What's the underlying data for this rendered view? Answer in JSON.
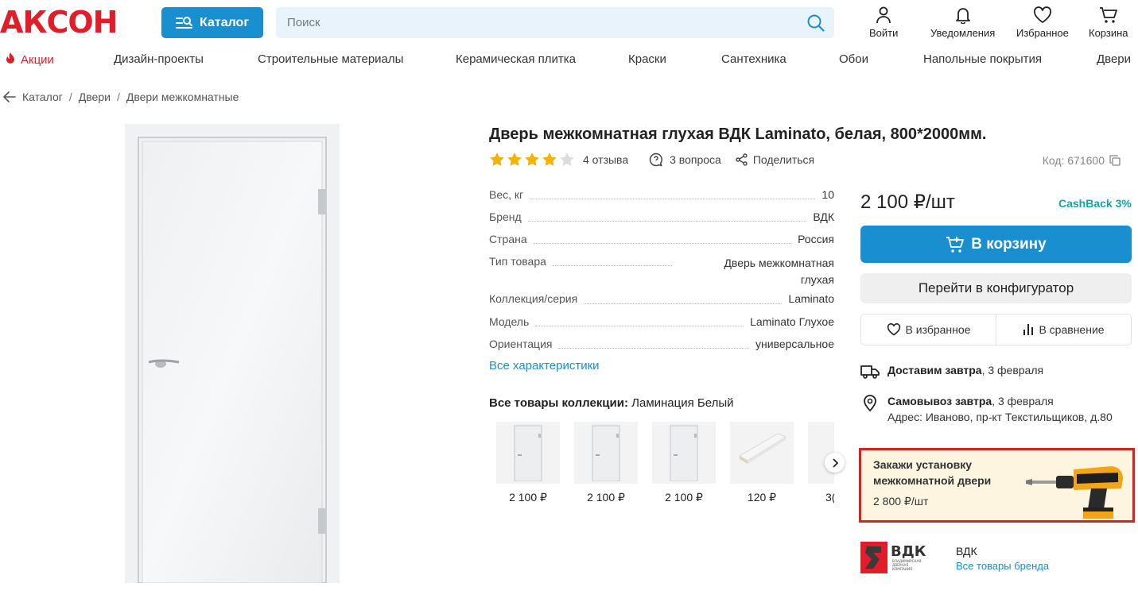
{
  "header": {
    "logo": "АКСОН",
    "catalog_label": "Каталог",
    "search_placeholder": "Поиск",
    "login_label": "Войти",
    "notifications_label": "Уведомления",
    "favorites_label": "Избранное",
    "cart_label": "Корзина"
  },
  "nav": {
    "items": [
      "Акции",
      "Дизайн-проекты",
      "Строительные материалы",
      "Керамическая плитка",
      "Краски",
      "Сантехника",
      "Обои",
      "Напольные покрытия",
      "Двери"
    ]
  },
  "breadcrumb": [
    "Каталог",
    "Двери",
    "Двери межкомнатные"
  ],
  "product": {
    "title": "Дверь межкомнатная глухая ВДК Laminato, белая, 800*2000мм.",
    "rating": 4,
    "reviews": "4 отзыва",
    "questions": "3 вопроса",
    "share": "Поделиться",
    "code": "Код: 671600",
    "specs": [
      {
        "name": "Вес, кг",
        "value": "10"
      },
      {
        "name": "Бренд",
        "value": "ВДК"
      },
      {
        "name": "Страна",
        "value": "Россия"
      },
      {
        "name": "Тип товара",
        "value_line1": "Дверь межкомнатная",
        "value_line2": "глухая"
      },
      {
        "name": "Коллекция/серия",
        "value": "Laminato"
      },
      {
        "name": "Модель",
        "value": "Laminato Глухое"
      },
      {
        "name": "Ориентация",
        "value": "универсальное"
      }
    ],
    "all_specs": "Все характеристики",
    "collection_label": "Все товары коллекции:",
    "collection_name": "Ламинация Белый",
    "collection_items": [
      {
        "price": "2 100 ₽"
      },
      {
        "price": "2 100 ₽"
      },
      {
        "price": "2 100 ₽"
      },
      {
        "price": "120 ₽"
      },
      {
        "price": "3("
      }
    ]
  },
  "buy": {
    "price": "2 100 ₽/шт",
    "cashback": "CashBack 3%",
    "cart_button": "В корзину",
    "config_button": "Перейти в конфигуратор",
    "favorite_button": "В избранное",
    "compare_button": "В сравнение",
    "delivery_bold": "Доставим завтра",
    "delivery_date": ", 3 февраля",
    "pickup_bold": "Самовывоз завтра",
    "pickup_date": ", 3 февраля",
    "pickup_address": "Адрес: Иваново, пр-кт Текстильщиков, д.80"
  },
  "promo": {
    "line1": "Закажи установку",
    "line2": "межкомнатной двери",
    "price": "2 800 ₽/шт"
  },
  "brand": {
    "logo_text": "ВДК",
    "logo_sub": "ВЛАДИМИРСКАЯ ДВЕРНАЯ КОМПАНИЯ",
    "name": "ВДК",
    "link": "Все товары бренда"
  },
  "colors": {
    "accent": "#1a8fd0",
    "brand_red": "#e11d2a",
    "star": "#f5b301",
    "cashback": "#19a3a3",
    "promo_border": "#d42323"
  }
}
